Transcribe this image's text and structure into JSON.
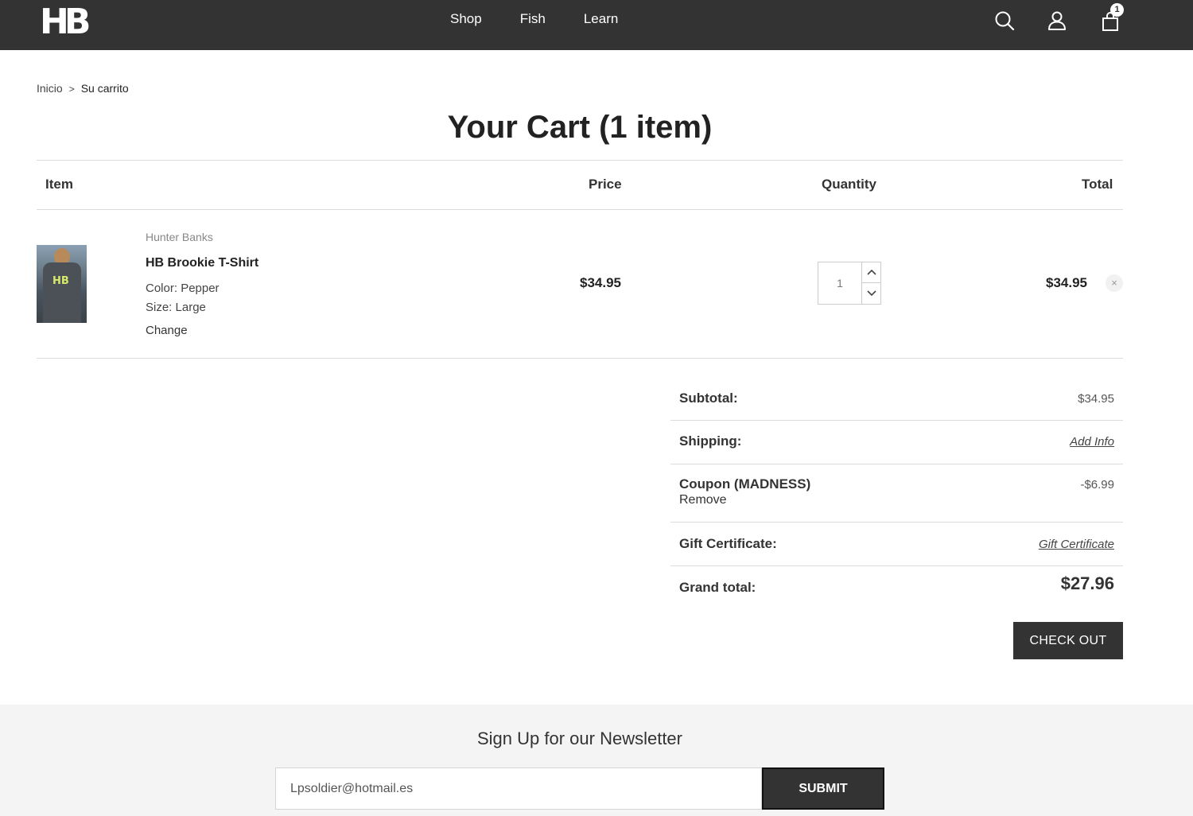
{
  "header": {
    "logo_text": "HB",
    "nav": [
      "Shop",
      "Fish",
      "Learn"
    ],
    "cart_count": "1",
    "icons": [
      "search-icon",
      "account-icon",
      "cart-icon"
    ]
  },
  "breadcrumb": {
    "home": "Inicio",
    "separator": ">",
    "current": "Su carrito"
  },
  "cart": {
    "title": "Your Cart (1 item)",
    "columns": {
      "item": "Item",
      "price": "Price",
      "quantity": "Quantity",
      "total": "Total"
    },
    "items": [
      {
        "brand": "Hunter Banks",
        "name": "HB Brookie T-Shirt",
        "color_label": "Color:",
        "color_value": "Pepper",
        "size_label": "Size:",
        "size_value": "Large",
        "change_label": "Change",
        "price": "$34.95",
        "quantity": "1",
        "total": "$34.95",
        "remove_label": "×"
      }
    ]
  },
  "summary": {
    "subtotal_label": "Subtotal:",
    "subtotal_value": "$34.95",
    "shipping_label": "Shipping:",
    "shipping_link": "Add Info",
    "coupon_label": "Coupon (MADNESS)",
    "coupon_value": "-$6.99",
    "coupon_remove": "Remove",
    "gift_label": "Gift Certificate:",
    "gift_link": "Gift Certificate",
    "grand_label": "Grand total:",
    "grand_value": "$27.96",
    "checkout_label": "CHECK OUT"
  },
  "newsletter": {
    "title": "Sign Up for our Newsletter",
    "email_value": "Lpsoldier@hotmail.es",
    "submit_label": "SUBMIT"
  },
  "colors": {
    "header_bg": "#333333",
    "button_bg": "#333333",
    "footer_bg": "#f4f4f4"
  }
}
